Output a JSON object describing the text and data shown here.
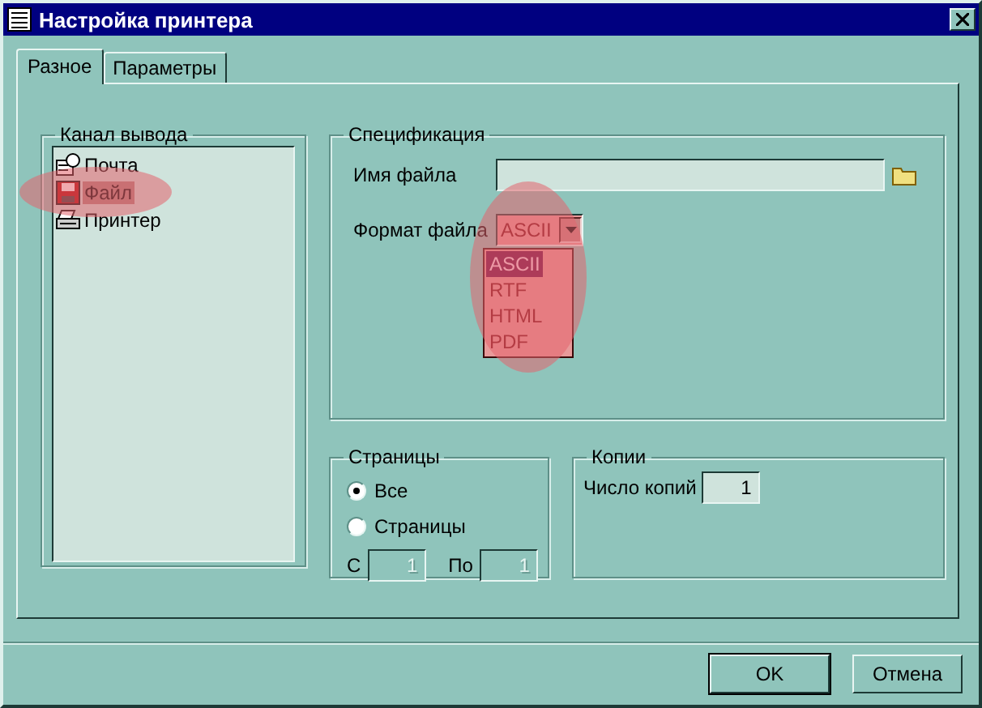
{
  "window": {
    "title": "Настройка принтера"
  },
  "tabs": [
    {
      "label": "Разное",
      "selected": true
    },
    {
      "label": "Параметры",
      "selected": false
    }
  ],
  "output_channel": {
    "title": "Канал вывода",
    "items": [
      {
        "kind": "mail",
        "label": "Почта",
        "selected": false,
        "highlighted": false
      },
      {
        "kind": "file",
        "label": "Файл",
        "selected": true,
        "highlighted": true
      },
      {
        "kind": "printer",
        "label": "Принтер",
        "selected": false,
        "highlighted": false
      }
    ]
  },
  "specification": {
    "title": "Спецификация",
    "file_name": {
      "label": "Имя файла"
    },
    "file_format": {
      "label": "Формат файла",
      "value": "ASCII",
      "expanded": true,
      "highlighted": true,
      "options": [
        {
          "label": "ASCII",
          "selected": true
        },
        {
          "label": "RTF",
          "selected": false
        },
        {
          "label": "HTML",
          "selected": false
        },
        {
          "label": "PDF",
          "selected": false
        }
      ]
    }
  },
  "pages": {
    "title": "Страницы",
    "options": [
      {
        "label": "Все",
        "selected": true
      },
      {
        "label": "Страницы",
        "selected": false
      }
    ],
    "from": {
      "label": "С",
      "value": "1",
      "disabled": true
    },
    "to": {
      "label": "По",
      "value": "1",
      "disabled": true
    }
  },
  "copies": {
    "title": "Копии",
    "label": "Число копий",
    "value": "1"
  },
  "buttons": [
    {
      "label": "OK",
      "default": true
    },
    {
      "label": "Отмена",
      "default": false
    }
  ]
}
